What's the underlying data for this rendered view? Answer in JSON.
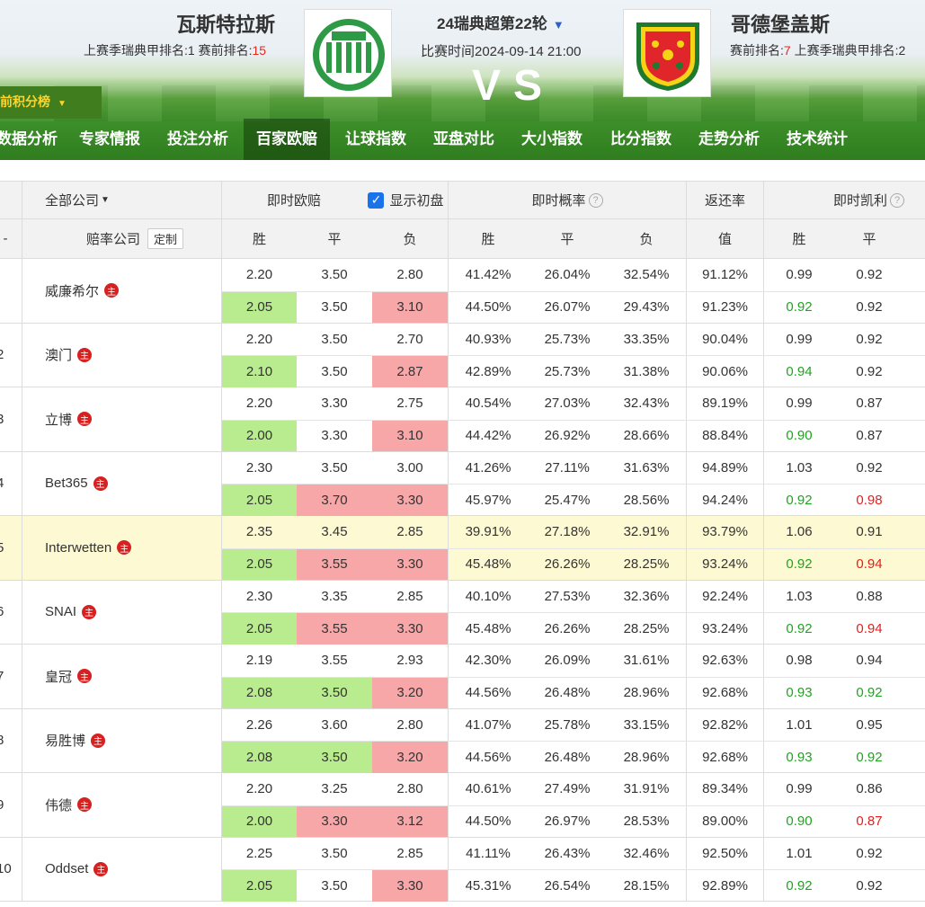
{
  "match": {
    "home_name": "瓦斯特拉斯",
    "home_rank_prefix": "上赛季瑞典甲排名:1  赛前排名:",
    "home_rank_value": "15",
    "away_name": "哥德堡盖斯",
    "away_rank_prefix": "赛前排名:",
    "away_rank_value": "7",
    "away_rank_suffix": "  上赛季瑞典甲排名:2",
    "league": "24瑞典超第22轮",
    "time": "比赛时间2024-09-14 21:00",
    "vs": "VS",
    "standings": "前积分榜"
  },
  "nav": [
    "数据分析",
    "专家情报",
    "投注分析",
    "百家欧赔",
    "让球指数",
    "亚盘对比",
    "大小指数",
    "比分指数",
    "走势分析",
    "技术统计"
  ],
  "header": {
    "all_companies": "全部公司",
    "live_euro": "即时欧赔",
    "show_initial": "显示初盘",
    "live_prob": "即时概率",
    "return_rate": "返还率",
    "live_kelly": "即时凯利",
    "company_col": "赔率公司",
    "custom": "定制",
    "win": "胜",
    "draw": "平",
    "lose": "负",
    "value": "值",
    "idx_dash": "-"
  },
  "zhu_label": "主",
  "colors": {
    "green_cell": "#b9ec8f",
    "pink_cell": "#f8a7a9",
    "highlight_row": "#fdf9d2"
  },
  "rows": [
    {
      "idx": "",
      "name": "威廉希尔",
      "hl": false,
      "a": [
        [
          "2.20",
          ""
        ],
        [
          "3.50",
          ""
        ],
        [
          "2.80",
          ""
        ],
        [
          "41.42%",
          ""
        ],
        [
          "26.04%",
          ""
        ],
        [
          "32.54%",
          ""
        ],
        [
          "91.12%",
          ""
        ],
        [
          "0.99",
          ""
        ],
        [
          "0.92",
          ""
        ]
      ],
      "b": [
        [
          "2.05",
          "green"
        ],
        [
          "3.50",
          ""
        ],
        [
          "3.10",
          "pink"
        ],
        [
          "44.50%",
          ""
        ],
        [
          "26.07%",
          ""
        ],
        [
          "29.43%",
          ""
        ],
        [
          "91.23%",
          ""
        ],
        [
          "0.92",
          "tg"
        ],
        [
          "0.92",
          ""
        ]
      ]
    },
    {
      "idx": "2",
      "name": "澳门",
      "hl": false,
      "a": [
        [
          "2.20",
          ""
        ],
        [
          "3.50",
          ""
        ],
        [
          "2.70",
          ""
        ],
        [
          "40.93%",
          ""
        ],
        [
          "25.73%",
          ""
        ],
        [
          "33.35%",
          ""
        ],
        [
          "90.04%",
          ""
        ],
        [
          "0.99",
          ""
        ],
        [
          "0.92",
          ""
        ]
      ],
      "b": [
        [
          "2.10",
          "green"
        ],
        [
          "3.50",
          ""
        ],
        [
          "2.87",
          "pink"
        ],
        [
          "42.89%",
          ""
        ],
        [
          "25.73%",
          ""
        ],
        [
          "31.38%",
          ""
        ],
        [
          "90.06%",
          ""
        ],
        [
          "0.94",
          "tg"
        ],
        [
          "0.92",
          ""
        ]
      ]
    },
    {
      "idx": "3",
      "name": "立博",
      "hl": false,
      "a": [
        [
          "2.20",
          ""
        ],
        [
          "3.30",
          ""
        ],
        [
          "2.75",
          ""
        ],
        [
          "40.54%",
          ""
        ],
        [
          "27.03%",
          ""
        ],
        [
          "32.43%",
          ""
        ],
        [
          "89.19%",
          ""
        ],
        [
          "0.99",
          ""
        ],
        [
          "0.87",
          ""
        ]
      ],
      "b": [
        [
          "2.00",
          "green"
        ],
        [
          "3.30",
          ""
        ],
        [
          "3.10",
          "pink"
        ],
        [
          "44.42%",
          ""
        ],
        [
          "26.92%",
          ""
        ],
        [
          "28.66%",
          ""
        ],
        [
          "88.84%",
          ""
        ],
        [
          "0.90",
          "tg"
        ],
        [
          "0.87",
          ""
        ]
      ]
    },
    {
      "idx": "4",
      "name": "Bet365",
      "hl": false,
      "a": [
        [
          "2.30",
          ""
        ],
        [
          "3.50",
          ""
        ],
        [
          "3.00",
          ""
        ],
        [
          "41.26%",
          ""
        ],
        [
          "27.11%",
          ""
        ],
        [
          "31.63%",
          ""
        ],
        [
          "94.89%",
          ""
        ],
        [
          "1.03",
          ""
        ],
        [
          "0.92",
          ""
        ]
      ],
      "b": [
        [
          "2.05",
          "green"
        ],
        [
          "3.70",
          "pink"
        ],
        [
          "3.30",
          "pink"
        ],
        [
          "45.97%",
          ""
        ],
        [
          "25.47%",
          ""
        ],
        [
          "28.56%",
          ""
        ],
        [
          "94.24%",
          ""
        ],
        [
          "0.92",
          "tg"
        ],
        [
          "0.98",
          "tr"
        ]
      ]
    },
    {
      "idx": "5",
      "name": "Interwetten",
      "hl": true,
      "a": [
        [
          "2.35",
          ""
        ],
        [
          "3.45",
          ""
        ],
        [
          "2.85",
          ""
        ],
        [
          "39.91%",
          ""
        ],
        [
          "27.18%",
          ""
        ],
        [
          "32.91%",
          ""
        ],
        [
          "93.79%",
          ""
        ],
        [
          "1.06",
          ""
        ],
        [
          "0.91",
          ""
        ]
      ],
      "b": [
        [
          "2.05",
          "green"
        ],
        [
          "3.55",
          "pink"
        ],
        [
          "3.30",
          "pink"
        ],
        [
          "45.48%",
          ""
        ],
        [
          "26.26%",
          ""
        ],
        [
          "28.25%",
          ""
        ],
        [
          "93.24%",
          ""
        ],
        [
          "0.92",
          "tg"
        ],
        [
          "0.94",
          "tr"
        ]
      ]
    },
    {
      "idx": "6",
      "name": "SNAI",
      "hl": false,
      "a": [
        [
          "2.30",
          ""
        ],
        [
          "3.35",
          ""
        ],
        [
          "2.85",
          ""
        ],
        [
          "40.10%",
          ""
        ],
        [
          "27.53%",
          ""
        ],
        [
          "32.36%",
          ""
        ],
        [
          "92.24%",
          ""
        ],
        [
          "1.03",
          ""
        ],
        [
          "0.88",
          ""
        ]
      ],
      "b": [
        [
          "2.05",
          "green"
        ],
        [
          "3.55",
          "pink"
        ],
        [
          "3.30",
          "pink"
        ],
        [
          "45.48%",
          ""
        ],
        [
          "26.26%",
          ""
        ],
        [
          "28.25%",
          ""
        ],
        [
          "93.24%",
          ""
        ],
        [
          "0.92",
          "tg"
        ],
        [
          "0.94",
          "tr"
        ]
      ]
    },
    {
      "idx": "7",
      "name": "皇冠",
      "hl": false,
      "a": [
        [
          "2.19",
          ""
        ],
        [
          "3.55",
          ""
        ],
        [
          "2.93",
          ""
        ],
        [
          "42.30%",
          ""
        ],
        [
          "26.09%",
          ""
        ],
        [
          "31.61%",
          ""
        ],
        [
          "92.63%",
          ""
        ],
        [
          "0.98",
          ""
        ],
        [
          "0.94",
          ""
        ]
      ],
      "b": [
        [
          "2.08",
          "green"
        ],
        [
          "3.50",
          "green"
        ],
        [
          "3.20",
          "pink"
        ],
        [
          "44.56%",
          ""
        ],
        [
          "26.48%",
          ""
        ],
        [
          "28.96%",
          ""
        ],
        [
          "92.68%",
          ""
        ],
        [
          "0.93",
          "tg"
        ],
        [
          "0.92",
          "tg"
        ]
      ]
    },
    {
      "idx": "8",
      "name": "易胜博",
      "hl": false,
      "a": [
        [
          "2.26",
          ""
        ],
        [
          "3.60",
          ""
        ],
        [
          "2.80",
          ""
        ],
        [
          "41.07%",
          ""
        ],
        [
          "25.78%",
          ""
        ],
        [
          "33.15%",
          ""
        ],
        [
          "92.82%",
          ""
        ],
        [
          "1.01",
          ""
        ],
        [
          "0.95",
          ""
        ]
      ],
      "b": [
        [
          "2.08",
          "green"
        ],
        [
          "3.50",
          "green"
        ],
        [
          "3.20",
          "pink"
        ],
        [
          "44.56%",
          ""
        ],
        [
          "26.48%",
          ""
        ],
        [
          "28.96%",
          ""
        ],
        [
          "92.68%",
          ""
        ],
        [
          "0.93",
          "tg"
        ],
        [
          "0.92",
          "tg"
        ]
      ]
    },
    {
      "idx": "9",
      "name": "伟德",
      "hl": false,
      "a": [
        [
          "2.20",
          ""
        ],
        [
          "3.25",
          ""
        ],
        [
          "2.80",
          ""
        ],
        [
          "40.61%",
          ""
        ],
        [
          "27.49%",
          ""
        ],
        [
          "31.91%",
          ""
        ],
        [
          "89.34%",
          ""
        ],
        [
          "0.99",
          ""
        ],
        [
          "0.86",
          ""
        ]
      ],
      "b": [
        [
          "2.00",
          "green"
        ],
        [
          "3.30",
          "pink"
        ],
        [
          "3.12",
          "pink"
        ],
        [
          "44.50%",
          ""
        ],
        [
          "26.97%",
          ""
        ],
        [
          "28.53%",
          ""
        ],
        [
          "89.00%",
          ""
        ],
        [
          "0.90",
          "tg"
        ],
        [
          "0.87",
          "tr"
        ]
      ]
    },
    {
      "idx": "10",
      "name": "Oddset",
      "hl": false,
      "a": [
        [
          "2.25",
          ""
        ],
        [
          "3.50",
          ""
        ],
        [
          "2.85",
          ""
        ],
        [
          "41.11%",
          ""
        ],
        [
          "26.43%",
          ""
        ],
        [
          "32.46%",
          ""
        ],
        [
          "92.50%",
          ""
        ],
        [
          "1.01",
          ""
        ],
        [
          "0.92",
          ""
        ]
      ],
      "b": [
        [
          "2.05",
          "green"
        ],
        [
          "3.50",
          ""
        ],
        [
          "3.30",
          "pink"
        ],
        [
          "45.31%",
          ""
        ],
        [
          "26.54%",
          ""
        ],
        [
          "28.15%",
          ""
        ],
        [
          "92.89%",
          ""
        ],
        [
          "0.92",
          "tg"
        ],
        [
          "0.92",
          ""
        ]
      ]
    }
  ]
}
